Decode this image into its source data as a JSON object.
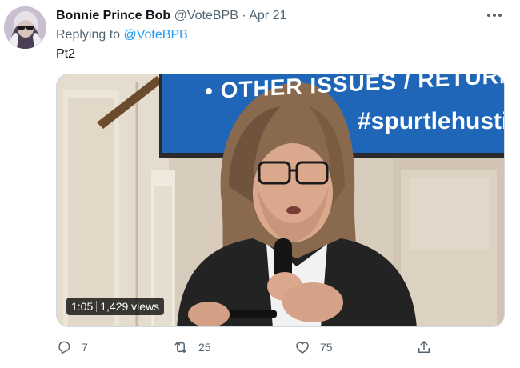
{
  "tweet": {
    "display_name": "Bonnie Prince Bob",
    "handle": "@VoteBPB",
    "separator": "·",
    "date": "Apr 21",
    "reply_prefix": "Replying to",
    "reply_handle": "@VoteBPB",
    "text": "Pt2"
  },
  "video": {
    "duration": "1:05",
    "views": "1,429 views",
    "slide_bullet_text": "• OTHER ISSUES / RETURN TO",
    "slide_hashtag": "#spurtlehusti"
  },
  "actions": {
    "reply_count": "7",
    "retweet_count": "25",
    "like_count": "75"
  },
  "icons": [
    "avatar",
    "more-icon",
    "reply-icon",
    "retweet-icon",
    "like-icon",
    "share-icon"
  ],
  "colors": {
    "link": "#1d9bf0",
    "secondary_text": "#536471",
    "primary_text": "#0f1419",
    "slide_blue": "#1f66b8"
  }
}
